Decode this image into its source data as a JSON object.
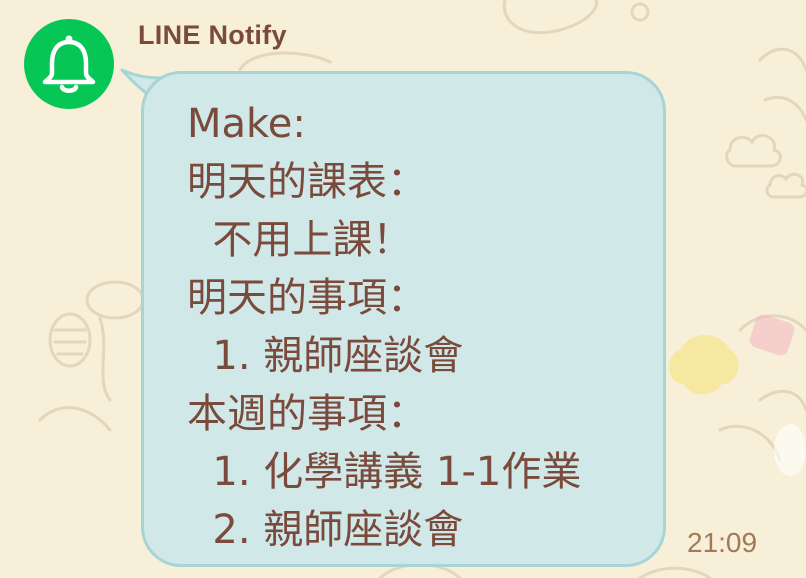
{
  "chat": {
    "sender": {
      "name": "LINE Notify",
      "avatar_icon": "bell-icon",
      "avatar_color": "#06c755"
    },
    "message": {
      "text": "Make:\n明天的課表：\n  不用上課！\n明天的事項：\n  1. 親師座談會\n本週的事項：\n  1. 化學講義 1-1作業\n  2. 親師座談會",
      "time": "21:09"
    },
    "colors": {
      "bubble": "#d0e8e7",
      "bubble_border": "#a7d4d4",
      "text": "#7a4a3d",
      "time": "#a17a58",
      "wallpaper": "#f7efd7"
    }
  }
}
